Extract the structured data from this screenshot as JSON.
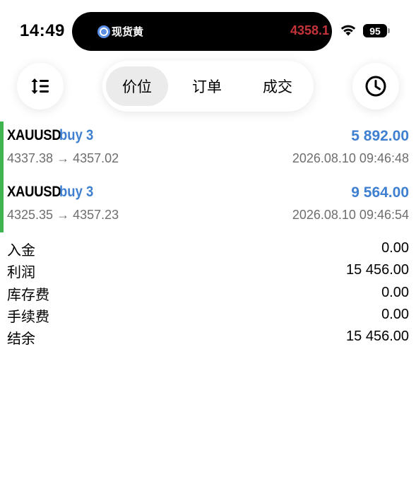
{
  "status_bar": {
    "time": "14:49",
    "live_activity_app": "现货黄",
    "live_activity_price": "4358.1",
    "battery": "95"
  },
  "toolbar": {
    "tabs": [
      {
        "label": "价位",
        "active": true
      },
      {
        "label": "订单",
        "active": false
      },
      {
        "label": "成交",
        "active": false
      }
    ]
  },
  "positions": [
    {
      "symbol": "XAUUSD",
      "side": "buy 3",
      "profit": "5 892.00",
      "price_range": "4337.38 → 4357.02",
      "time": "2026.08.10 09:46:48"
    },
    {
      "symbol": "XAUUSD",
      "side": "buy 3",
      "profit": "9 564.00",
      "price_range": "4325.35 → 4357.23",
      "time": "2026.08.10 09:46:54"
    }
  ],
  "summary": [
    {
      "label": "入金",
      "value": "0.00"
    },
    {
      "label": "利润",
      "value": "15 456.00"
    },
    {
      "label": "库存费",
      "value": "0.00"
    },
    {
      "label": "手续费",
      "value": "0.00"
    },
    {
      "label": "结余",
      "value": "15 456.00"
    }
  ],
  "colors": {
    "accent_blue": "#3f7fd0",
    "position_bar_green": "#3fb44f",
    "island_price_red": "#c5333b",
    "muted_text": "#6e6e6e"
  }
}
